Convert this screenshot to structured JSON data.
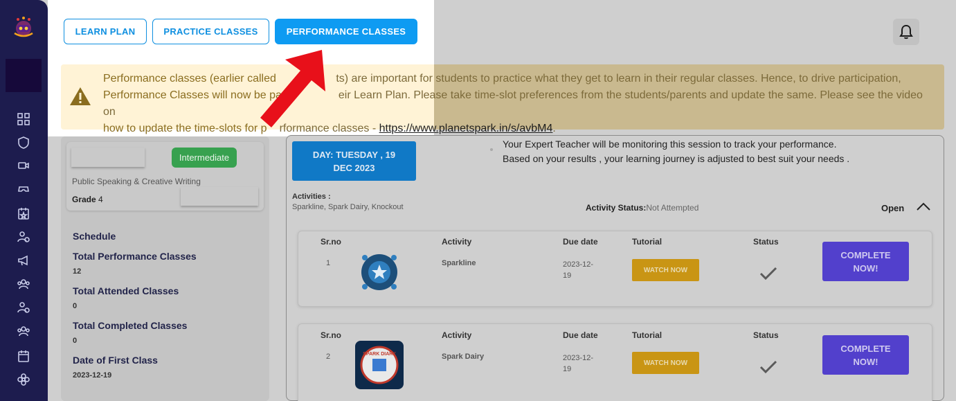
{
  "tabs": {
    "learn_plan": "LEARN PLAN",
    "practice": "PRACTICE CLASSES",
    "performance": "PERFORMANCE CLASSES"
  },
  "notice": {
    "line1_a": "Performance classes (earlier called ",
    "line1_b": "ts) are important for students to practice what they get to learn in their regular classes. Hence, to drive participation,",
    "line2_a": "Performance Classes will now be pa",
    "line2_b": "eir Learn Plan. Please take time-slot preferences from the students/parents and update the same. Please see the video on",
    "line3_a": "how to update the time-slots for p",
    "line3_b": "rformance classes - ",
    "link": "https://www.planetspark.in/s/avbM4",
    "line3_end": "."
  },
  "course": {
    "level": "Intermediate",
    "name": "Public Speaking & Creative Writing",
    "grade_label": "Grade",
    "grade_value": "4"
  },
  "stats": {
    "schedule": "Schedule",
    "total_performance_label": "Total Performance Classes",
    "total_performance_value": "12",
    "total_attended_label": "Total Attended Classes",
    "total_attended_value": "0",
    "total_completed_label": "Total Completed Classes",
    "total_completed_value": "0",
    "first_class_label": "Date of First Class",
    "first_class_value": "2023-12-19"
  },
  "session": {
    "day_line1": "DAY: TUESDAY , 19",
    "day_line2": "DEC 2023",
    "expert_line1": "Your Expert Teacher will be monitoring this session to track your performance.",
    "expert_line2": "Based on your results , your learning journey is adjusted to best suit your needs .",
    "activities_title": "Activities :",
    "activities_list": "Sparkline, Spark Dairy, Knockout",
    "activity_status_label": "Activity Status:",
    "activity_status_value": "Not Attempted",
    "open_label": "Open"
  },
  "table_headers": {
    "srno": "Sr.no",
    "activity": "Activity",
    "due_date": "Due date",
    "tutorial": "Tutorial",
    "status": "Status"
  },
  "activities": [
    {
      "srno": "1",
      "name": "Sparkline",
      "due_line1": "2023-12-",
      "due_line2": "19",
      "watch": "WATCH NOW",
      "complete_line1": "COMPLETE",
      "complete_line2": "NOW!"
    },
    {
      "srno": "2",
      "name": "Spark Dairy",
      "due_line1": "2023-12-",
      "due_line2": "19",
      "watch": "WATCH NOW",
      "complete_line1": "COMPLETE",
      "complete_line2": "NOW!"
    }
  ],
  "thumb2_text": "SPARK DIARY",
  "colors": {
    "sidebar": "#1d1c4e",
    "accent_blue": "#0e9bf2",
    "intermediate_green": "#37a14f",
    "watch_gold": "#c99514",
    "complete_purple": "#5240cc",
    "arrow_red": "#e8101a"
  }
}
